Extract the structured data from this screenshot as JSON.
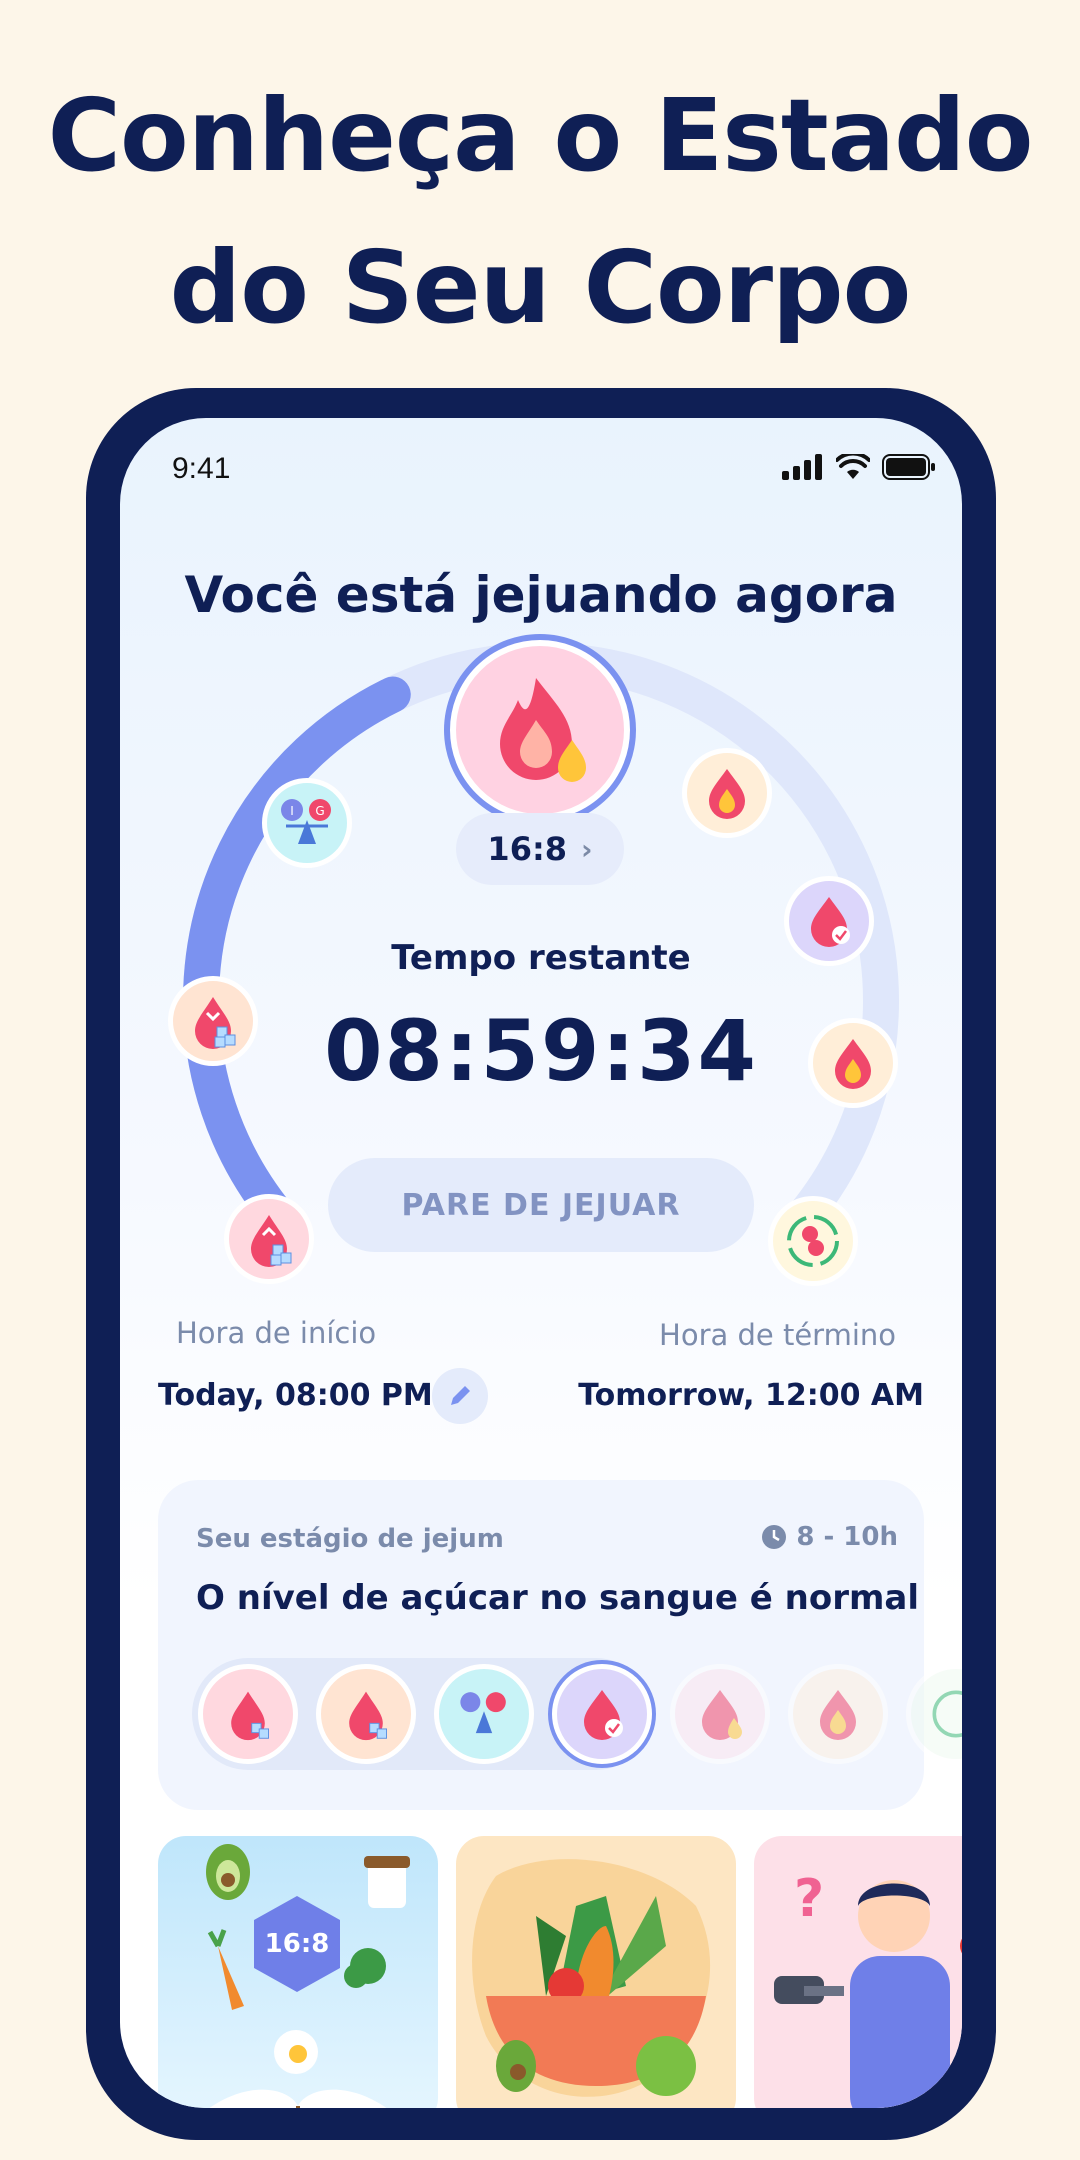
{
  "headline": {
    "line1": "Conheça o Estado",
    "line2": "do Seu Corpo"
  },
  "status_bar": {
    "time": "9:41"
  },
  "fasting": {
    "title": "Você está jejuando agora",
    "plan": "16:8",
    "remaining_label": "Tempo restante",
    "remaining_time": "08:59:34",
    "progress_fraction": 0.4,
    "stop_button": "PARE DE JEJUAR",
    "start_label": "Hora de início",
    "start_value": "Today, 08:00 PM",
    "end_label": "Hora de término",
    "end_value": "Tomorrow, 12:00 AM"
  },
  "ring_stages": [
    "blood-sugar-rising-icon",
    "blood-sugar-falling-icon",
    "insulin-glucagon-balance-icon",
    "fat-burning-flame-icon",
    "blood-sugar-normal-icon",
    "flame-icon",
    "autophagy-cells-icon"
  ],
  "stage_card": {
    "kicker": "Seu estágio de jejum",
    "hours": "8 - 10h",
    "title": "O nível de açúcar no sangue é normal",
    "chips": [
      "blood-sugar-rising-icon",
      "blood-sugar-falling-icon",
      "insulin-glucagon-balance-icon",
      "blood-sugar-normal-icon",
      "fat-burning-flame-icon",
      "flame-icon",
      "autophagy-cells-icon"
    ]
  },
  "articles": [
    {
      "badge": "16:8",
      "name": "fasting-guide-article"
    },
    {
      "name": "healthy-food-article"
    },
    {
      "name": "exercise-question-article"
    }
  ],
  "colors": {
    "navy": "#0f1f55",
    "accent_blue": "#7b92f0",
    "track": "#dfe7fb",
    "cream": "#fdf6e9",
    "pink": "#f0486b"
  }
}
